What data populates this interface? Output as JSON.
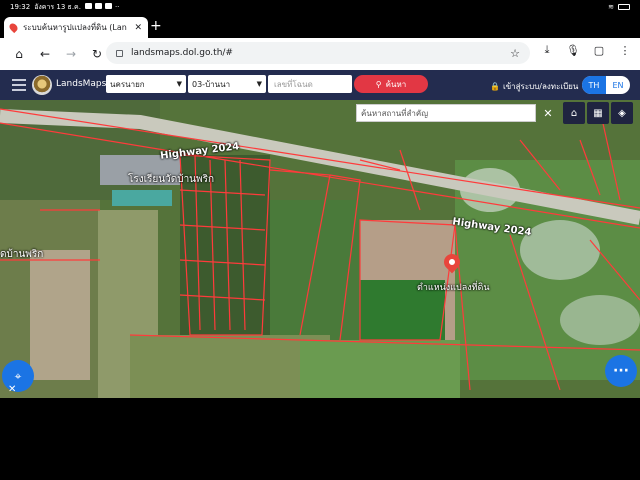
{
  "status_bar": {
    "time": "19:32",
    "date": "อังคาร 13 ธ.ค.",
    "icons": [
      "facebook-icon",
      "gallery-icon",
      "youtube-icon",
      "more-icon"
    ],
    "right_icons": [
      "wifi-icon",
      "battery-icon"
    ]
  },
  "browser": {
    "tab_title": "ระบบค้นหารูปแปลงที่ดิน (Lan",
    "tab_close": "✕",
    "new_tab": "+",
    "url": "landsmaps.dol.go.th/#"
  },
  "site": {
    "brand": "LandsMaps",
    "province_select": "นครนายก",
    "amphoe_select": "03-บ้านนา",
    "parcel_placeholder": "เลขที่โฉนด",
    "search_label": "ค้นหา",
    "login_label": "เข้าสู่ระบบ/ลงทะเบียน",
    "lang_th": "TH",
    "lang_en": "EN"
  },
  "map": {
    "search_placeholder": "ค้นหาสถานที่สำคัญ",
    "highway_label_1": "Highway 2024",
    "highway_label_2": "Highway 2024",
    "school_label": "โรงเรียนวัดบ้านพริก",
    "village_label": "ดบ้านพริก",
    "marker_label": "ตำแหน่งแปลงที่ดิน",
    "tools": [
      "home-icon",
      "grid-icon",
      "layers-icon"
    ]
  }
}
